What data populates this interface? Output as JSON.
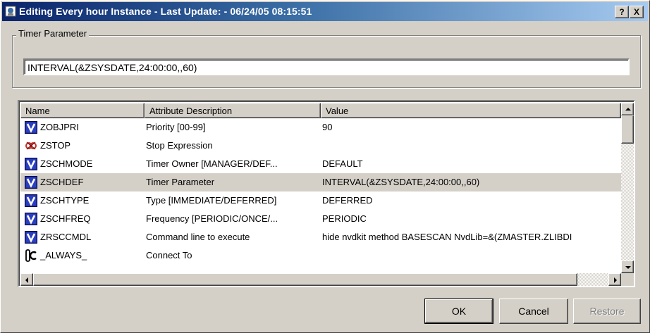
{
  "window": {
    "title": "Editing Every hour Instance - Last Update: - 06/24/05 08:15:51",
    "help_label": "?",
    "close_label": "X",
    "colors": {
      "titlebar_start": "#0a246a",
      "titlebar_end": "#a6caf0",
      "face": "#d4d0c8"
    }
  },
  "timer_group": {
    "legend": "Timer Parameter",
    "value": "INTERVAL(&ZSYSDATE,24:00:00,,60)"
  },
  "list": {
    "columns": [
      "Name",
      "Attribute Description",
      "Value"
    ],
    "rows": [
      {
        "icon": "variable-v-icon",
        "name": "ZOBJPRI",
        "desc": "Priority [00-99]",
        "value": "90"
      },
      {
        "icon": "stop-expression-icon",
        "name": "ZSTOP",
        "desc": "Stop Expression",
        "value": ""
      },
      {
        "icon": "variable-v-icon",
        "name": "ZSCHMODE",
        "desc": "Timer Owner [MANAGER/DEF...",
        "value": "DEFAULT"
      },
      {
        "icon": "variable-v-icon",
        "name": "ZSCHDEF",
        "desc": "Timer Parameter",
        "value": "INTERVAL(&ZSYSDATE,24:00:00,,60)",
        "selected": true
      },
      {
        "icon": "variable-v-icon",
        "name": "ZSCHTYPE",
        "desc": "Type [IMMEDIATE/DEFERRED]",
        "value": "DEFERRED"
      },
      {
        "icon": "variable-v-icon",
        "name": "ZSCHFREQ",
        "desc": "Frequency [PERIODIC/ONCE/...",
        "value": "PERIODIC"
      },
      {
        "icon": "variable-v-icon",
        "name": "ZRSCCMDL",
        "desc": "Command line to execute",
        "value": "hide nvdkit method BASESCAN NvdLib=&(ZMASTER.ZLIBDI"
      },
      {
        "icon": "connect-icon",
        "name": "_ALWAYS_",
        "desc": "Connect To",
        "value": ""
      }
    ]
  },
  "buttons": {
    "ok": "OK",
    "cancel": "Cancel",
    "restore": "Restore"
  }
}
